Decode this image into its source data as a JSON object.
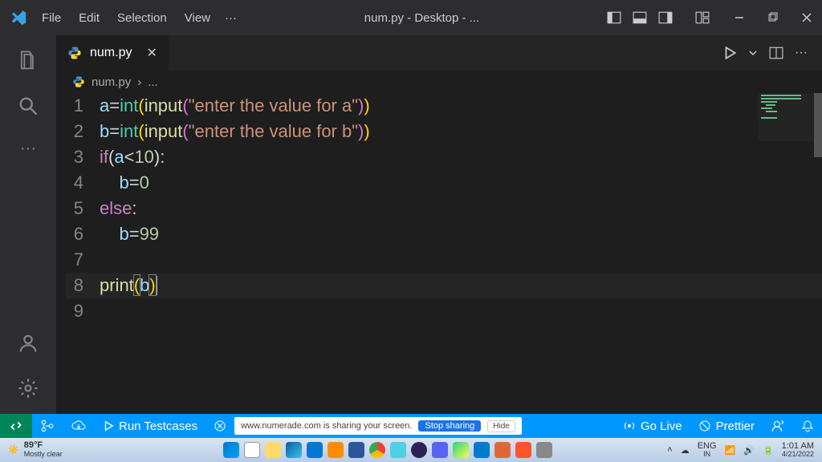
{
  "title_bar": {
    "menu": [
      "File",
      "Edit",
      "Selection",
      "View"
    ],
    "title": "num.py - Desktop - ...",
    "ellipsis": "···"
  },
  "tab": {
    "filename": "num.py",
    "close": "✕"
  },
  "breadcrumb": {
    "filename": "num.py",
    "chevron": "›",
    "ellipsis": "..."
  },
  "code_lines": [
    {
      "n": 1
    },
    {
      "n": 2
    },
    {
      "n": 3
    },
    {
      "n": 4
    },
    {
      "n": 5
    },
    {
      "n": 6
    },
    {
      "n": 7
    },
    {
      "n": 8
    },
    {
      "n": 9
    }
  ],
  "code_tokens": {
    "l1_a": "a",
    "l1_eq": "=",
    "l1_int": "int",
    "l1_lp": "(",
    "l1_input": "input",
    "l1_lp2": "(",
    "l1_str": "\"enter the value for a\"",
    "l1_rp2": ")",
    "l1_rp": ")",
    "l2_b": "b",
    "l2_eq": "=",
    "l2_int": "int",
    "l2_lp": "(",
    "l2_input": "input",
    "l2_lp2": "(",
    "l2_str": "\"enter the value for b\"",
    "l2_rp2": ")",
    "l2_rp": ")",
    "l3_if": "if",
    "l3_lp": "(",
    "l3_a": "a",
    "l3_op": "<",
    "l3_10": "10",
    "l3_rp": ")",
    "l3_col": ":",
    "l4_indent": "    ",
    "l4_b": "b",
    "l4_eq": "=",
    "l4_0": "0",
    "l5_else": "else",
    "l5_col": ":",
    "l6_indent": "    ",
    "l6_b": "b",
    "l6_eq": "=",
    "l6_99": "99",
    "l8_print": "print",
    "l8_lp": "(",
    "l8_b": "b",
    "l8_rp": ")"
  },
  "status_bar": {
    "run": "Run Testcases",
    "share_text": "www.numerade.com is sharing your screen.",
    "share_stop": "Stop sharing",
    "share_hide": "Hide",
    "golive": "Go Live",
    "prettier": "Prettier"
  },
  "taskbar": {
    "temp": "89°F",
    "cond": "Mostly clear",
    "lang": "ENG",
    "region": "IN",
    "time": "1:01 AM",
    "date": "4/21/2022"
  }
}
